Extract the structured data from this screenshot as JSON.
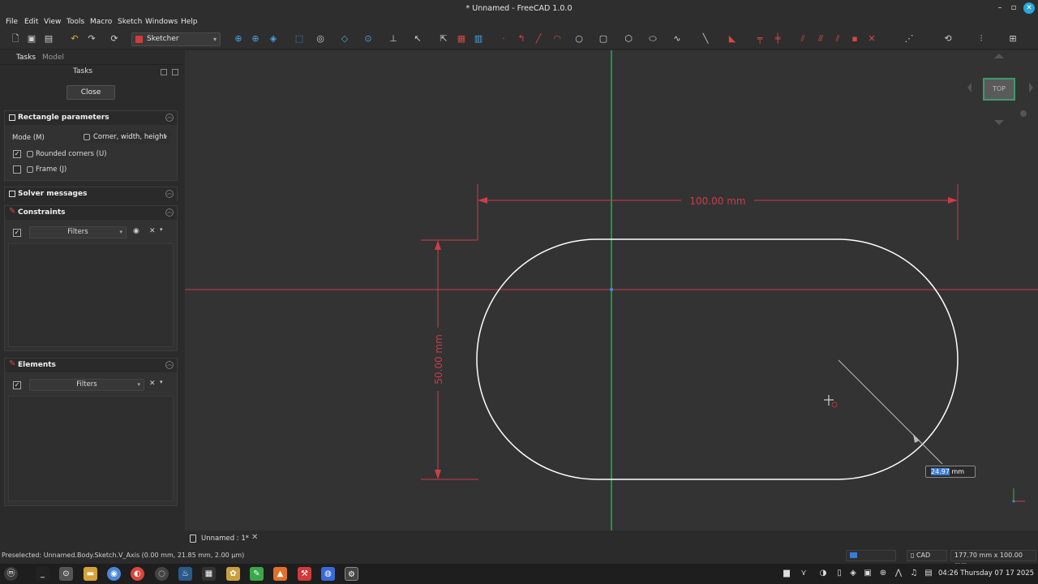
{
  "window": {
    "title": "* Unnamed - FreeCAD 1.0.0"
  },
  "menu": {
    "items": [
      "File",
      "Edit",
      "View",
      "Tools",
      "Macro",
      "Sketch",
      "Windows",
      "Help"
    ]
  },
  "toolbar": {
    "workbench": "Sketcher"
  },
  "panel": {
    "tabs": {
      "tasks": "Tasks",
      "model": "Model"
    },
    "tasks_title": "Tasks",
    "close_label": "Close",
    "rect_params": {
      "title": "Rectangle parameters",
      "mode_label": "Mode (M)",
      "mode_value": "Corner, width, height",
      "rounded_label": "Rounded corners (U)",
      "rounded_checked": true,
      "frame_label": "Frame (J)",
      "frame_checked": false
    },
    "solver": {
      "title": "Solver messages"
    },
    "constraints": {
      "title": "Constraints",
      "filter": "Filters"
    },
    "elements": {
      "title": "Elements",
      "filter": "Filters"
    }
  },
  "viewport": {
    "navcube_face": "TOP",
    "dim_width": "100.00 mm",
    "dim_height": "50.00 mm",
    "radius_input_value": "24.97",
    "radius_input_unit": "mm",
    "colors": {
      "background": "#333333",
      "v_axis": "#22c24a",
      "h_axis": "#cc3c4a",
      "geometry": "#ffffff",
      "dimension": "#cc3c4a"
    }
  },
  "doc_tab": {
    "label": "Unnamed : 1*"
  },
  "statusbar": {
    "message": "Preselected: Unnamed.Body.Sketch.V_Axis (0.00 mm, 21.85 mm, 2.00 µm)",
    "nav_style": "CAD",
    "dimensions": "177.70 mm x 100.00 mm"
  },
  "taskbar": {
    "clock": "04:26 Thursday 07 17 2025"
  }
}
